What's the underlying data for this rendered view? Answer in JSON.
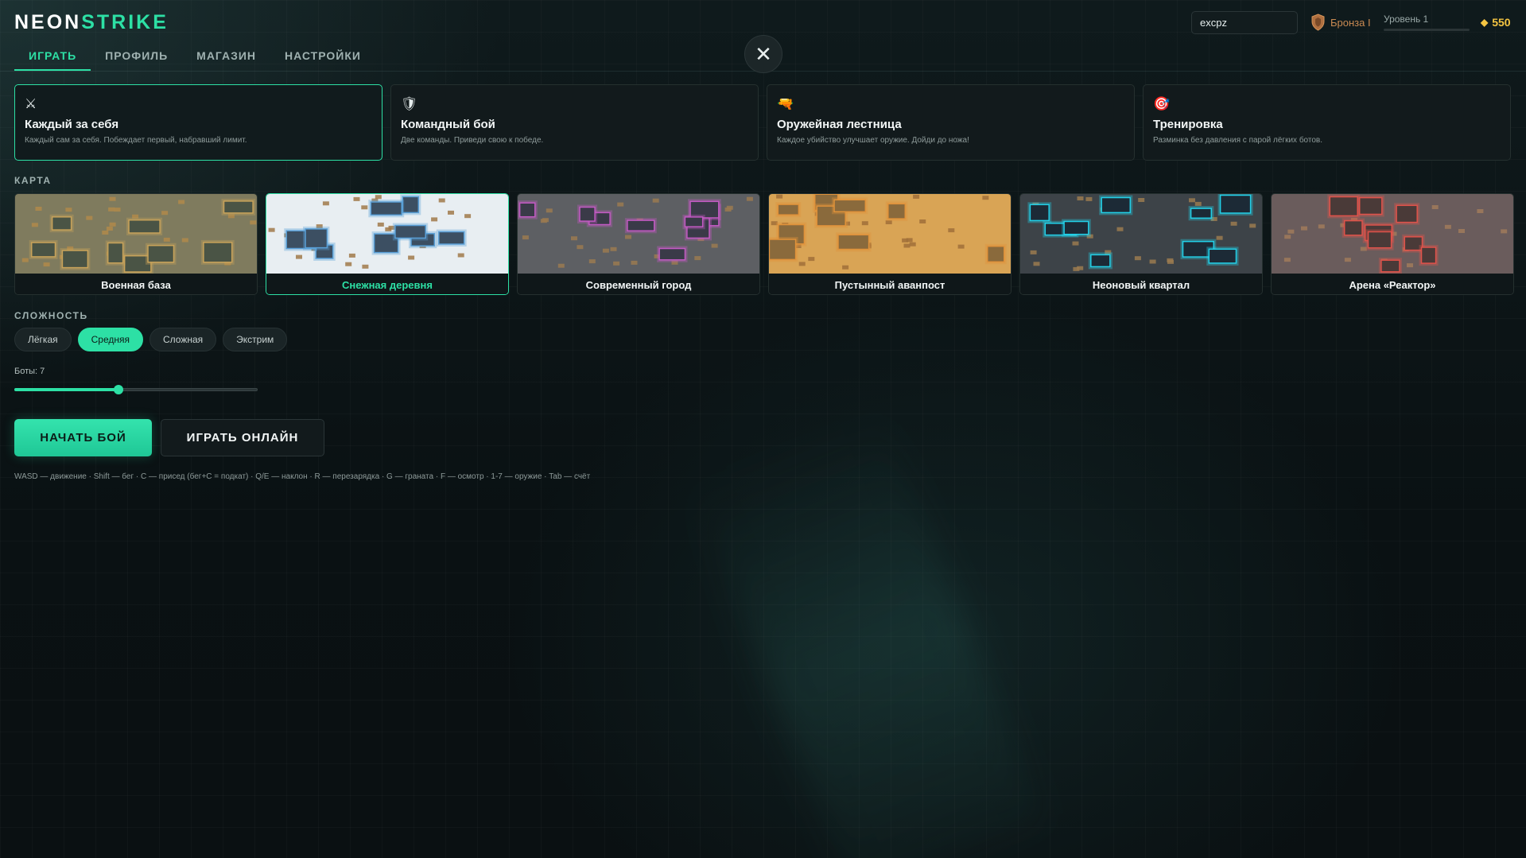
{
  "logo": {
    "part1": "NEON",
    "part2": "STRIKE"
  },
  "nav": {
    "tabs": [
      {
        "label": "ИГРАТЬ",
        "active": true
      },
      {
        "label": "ПРОФИЛЬ",
        "active": false
      },
      {
        "label": "МАГАЗИН",
        "active": false
      },
      {
        "label": "НАСТРОЙКИ",
        "active": false
      }
    ]
  },
  "close_icon": "close-icon",
  "user": {
    "name_value": "excpz",
    "rank": "Бронза I",
    "level_label": "Уровень 1",
    "level_progress": 0,
    "coins": "550"
  },
  "modes": [
    {
      "icon": "⚔",
      "icon_name": "crossed-swords-icon",
      "title": "Каждый за себя",
      "desc": "Каждый сам за себя. Побеждает первый, набравший лимит.",
      "active": true
    },
    {
      "icon": "🛡",
      "icon_name": "shield-icon",
      "title": "Командный бой",
      "desc": "Две команды. Приведи свою к победе.",
      "active": false
    },
    {
      "icon": "🔫",
      "icon_name": "water-gun-icon",
      "title": "Оружейная лестница",
      "desc": "Каждое убийство улучшает оружие. Дойди до ножа!",
      "active": false
    },
    {
      "icon": "🎯",
      "icon_name": "target-icon",
      "title": "Тренировка",
      "desc": "Разминка без давления с парой лёгких ботов.",
      "active": false
    }
  ],
  "map_section_title": "КАРТА",
  "maps": [
    {
      "name": "Военная база",
      "active": false,
      "bg": "#7f7b5e",
      "block_fill": "#4a5445",
      "block_glow": "#c9a35a",
      "crate": "#b08a4a"
    },
    {
      "name": "Снежная деревня",
      "active": true,
      "bg": "#e8eef2",
      "block_fill": "#3c4f62",
      "block_glow": "#5aa0d8",
      "crate": "#a0794a"
    },
    {
      "name": "Современный город",
      "active": false,
      "bg": "#5d5f63",
      "block_fill": "#3a3a48",
      "block_glow": "#c45ac4",
      "crate": "#9a7a50"
    },
    {
      "name": "Пустынный аванпост",
      "active": false,
      "bg": "#d9a455",
      "block_fill": "#8a6a3c",
      "block_glow": "#e0923a",
      "crate": "#a0703a"
    },
    {
      "name": "Неоновый квартал",
      "active": false,
      "bg": "#3d4348",
      "block_fill": "#1c2a36",
      "block_glow": "#22d0e8",
      "crate": "#9a7a50"
    },
    {
      "name": "Арена «Реактор»",
      "active": false,
      "bg": "#6a5c5c",
      "block_fill": "#4a3a38",
      "block_glow": "#e0524a",
      "crate": "#a07a5a"
    }
  ],
  "difficulty_section_title": "СЛОЖНОСТЬ",
  "difficulties": [
    {
      "label": "Лёгкая",
      "active": false
    },
    {
      "label": "Средняя",
      "active": true
    },
    {
      "label": "Сложная",
      "active": false
    },
    {
      "label": "Экстрим",
      "active": false
    }
  ],
  "bots": {
    "label": "Боты: 7",
    "value": 7,
    "min": 1,
    "max": 15
  },
  "buttons": {
    "start": "НАЧАТЬ БОЙ",
    "online": "ИГРАТЬ ОНЛАЙН"
  },
  "controls_hint": "WASD — движение · Shift — бег · C — присед (бег+C = подкат) · Q/E — наклон · R — перезарядка · G — граната · F — осмотр · 1-7 — оружие · Tab — счёт"
}
